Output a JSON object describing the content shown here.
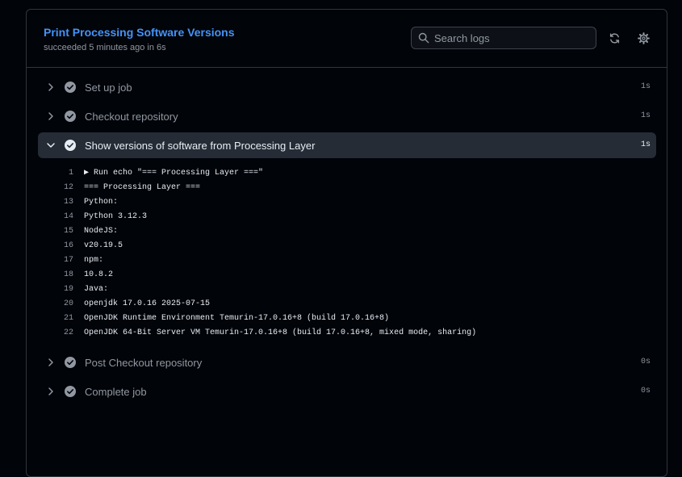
{
  "header": {
    "title": "Print Processing Software Versions",
    "subtitle": "succeeded 5 minutes ago in 6s",
    "search_placeholder": "Search logs"
  },
  "icons": {
    "search": "search-icon",
    "refresh": "refresh-icon",
    "settings": "gear-icon",
    "chevron_collapsed": "chevron-right-icon",
    "chevron_expanded": "chevron-down-icon",
    "status": "check-circle-icon"
  },
  "steps_before": [
    {
      "label": "Set up job",
      "duration": "1s"
    },
    {
      "label": "Checkout repository",
      "duration": "1s"
    }
  ],
  "expanded_step": {
    "label": "Show versions of software from Processing Layer",
    "duration": "1s",
    "log_lines": [
      {
        "num": "1",
        "text": "▶ Run echo \"=== Processing Layer ===\""
      },
      {
        "num": "12",
        "text": "=== Processing Layer ==="
      },
      {
        "num": "13",
        "text": "Python:"
      },
      {
        "num": "14",
        "text": "Python 3.12.3"
      },
      {
        "num": "15",
        "text": "NodeJS:"
      },
      {
        "num": "16",
        "text": "v20.19.5"
      },
      {
        "num": "17",
        "text": "npm:"
      },
      {
        "num": "18",
        "text": "10.8.2"
      },
      {
        "num": "19",
        "text": "Java:"
      },
      {
        "num": "20",
        "text": "openjdk 17.0.16 2025-07-15"
      },
      {
        "num": "21",
        "text": "OpenJDK Runtime Environment Temurin-17.0.16+8 (build 17.0.16+8)"
      },
      {
        "num": "22",
        "text": "OpenJDK 64-Bit Server VM Temurin-17.0.16+8 (build 17.0.16+8, mixed mode, sharing)"
      }
    ]
  },
  "steps_after": [
    {
      "label": "Post Checkout repository",
      "duration": "0s"
    },
    {
      "label": "Complete job",
      "duration": "0s"
    }
  ],
  "colors": {
    "background": "#010409",
    "accent": "#4493f8",
    "muted": "#9198a1",
    "expanded_row": "#262c36",
    "border": "#30363d"
  }
}
